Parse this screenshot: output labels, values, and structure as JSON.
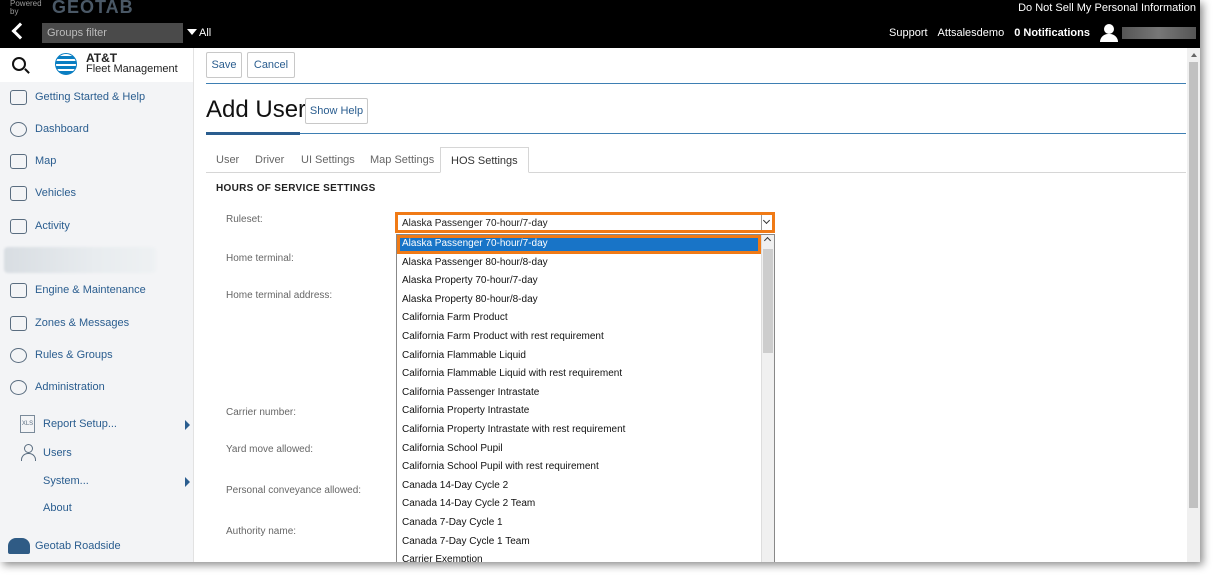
{
  "topbar": {
    "powered_by": "Powered by",
    "logo": "GEOTAB",
    "do_not_sell": "Do Not Sell My Personal Information",
    "groups_filter_placeholder": "Groups filter",
    "all_label": "All",
    "support": "Support",
    "account": "Attsalesdemo",
    "notifications": "0 Notifications"
  },
  "sidebar": {
    "brand_line1": "AT&T",
    "brand_line2": "Fleet Management",
    "items": [
      {
        "label": "Getting Started & Help"
      },
      {
        "label": "Dashboard"
      },
      {
        "label": "Map"
      },
      {
        "label": "Vehicles"
      },
      {
        "label": "Activity"
      },
      {
        "label": "Engine & Maintenance"
      },
      {
        "label": "Zones & Messages"
      },
      {
        "label": "Rules & Groups"
      },
      {
        "label": "Administration"
      }
    ],
    "sub_items": [
      {
        "label": "Report Setup..."
      },
      {
        "label": "Users"
      },
      {
        "label": "System..."
      },
      {
        "label": "About"
      }
    ],
    "roadside": "Geotab Roadside"
  },
  "toolbar": {
    "save_label": "Save",
    "cancel_label": "Cancel"
  },
  "page": {
    "title": "Add User",
    "show_help": "Show Help"
  },
  "tabs": [
    {
      "label": "User"
    },
    {
      "label": "Driver"
    },
    {
      "label": "UI Settings"
    },
    {
      "label": "Map Settings"
    },
    {
      "label": "HOS Settings"
    }
  ],
  "hos": {
    "section_title": "HOURS OF SERVICE SETTINGS",
    "labels": {
      "ruleset": "Ruleset:",
      "home_terminal": "Home terminal:",
      "home_terminal_address": "Home terminal address:",
      "carrier_number": "Carrier number:",
      "yard_move": "Yard move allowed:",
      "personal_conveyance": "Personal conveyance allowed:",
      "authority_name": "Authority name:"
    },
    "ruleset_value": "Alaska Passenger 70-hour/7-day",
    "options": [
      "Alaska Passenger 70-hour/7-day",
      "Alaska Passenger 80-hour/8-day",
      "Alaska Property 70-hour/7-day",
      "Alaska Property 80-hour/8-day",
      "California Farm Product",
      "California Farm Product with rest requirement",
      "California Flammable Liquid",
      "California Flammable Liquid with rest requirement",
      "California Passenger Intrastate",
      "California Property Intrastate",
      "California Property Intrastate with rest requirement",
      "California School Pupil",
      "California School Pupil with rest requirement",
      "Canada 14-Day Cycle 2",
      "Canada 14-Day Cycle 2 Team",
      "Canada 7-Day Cycle 1",
      "Canada 7-Day Cycle 1 Team",
      "Carrier Exemption"
    ],
    "selected_index": 0
  },
  "colors": {
    "highlight_orange": "#f07a16",
    "selection_blue": "#1874c7",
    "link_blue": "#2a5d8f"
  }
}
